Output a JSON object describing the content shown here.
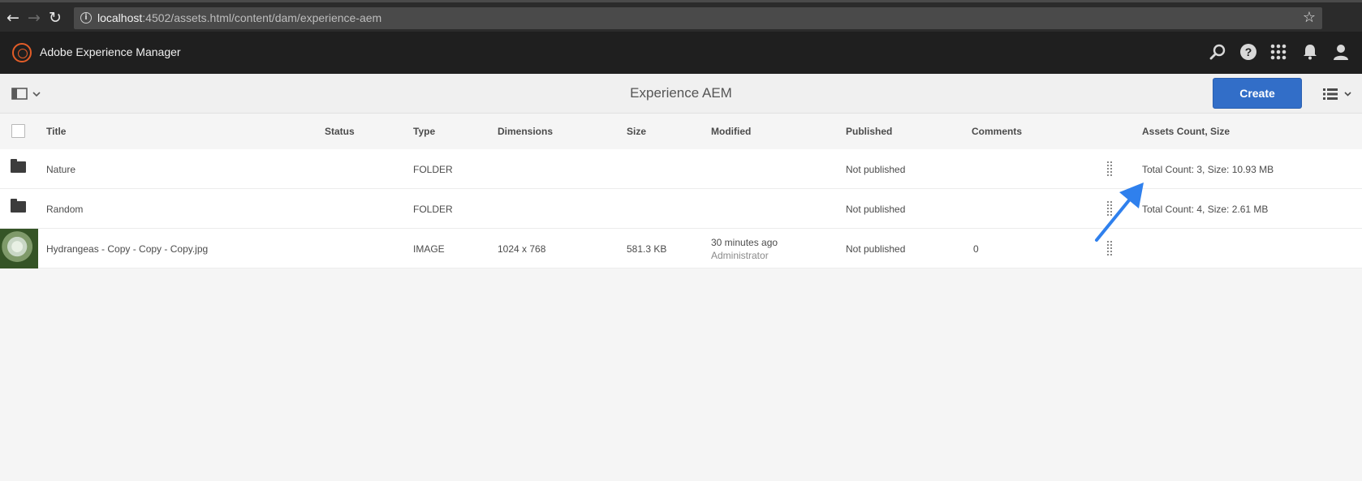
{
  "browser": {
    "url_host": "localhost",
    "url_rest": ":4502/assets.html/content/dam/experience-aem"
  },
  "header": {
    "app_title": "Adobe Experience Manager"
  },
  "action_bar": {
    "title": "Experience AEM",
    "create_label": "Create"
  },
  "table": {
    "columns": [
      "Title",
      "Status",
      "Type",
      "Dimensions",
      "Size",
      "Modified",
      "Published",
      "Comments",
      "Assets Count, Size"
    ],
    "rows": [
      {
        "title": "Nature",
        "type": "FOLDER",
        "published": "Not published",
        "assets": "Total Count: 3, Size: 10.93 MB"
      },
      {
        "title": "Random",
        "type": "FOLDER",
        "published": "Not published",
        "assets": "Total Count: 4, Size: 2.61 MB"
      },
      {
        "title": "Hydrangeas - Copy - Copy - Copy.jpg",
        "type": "IMAGE",
        "dimensions": "1024 x 768",
        "size": "581.3 KB",
        "modified": "30 minutes ago",
        "modified_by": "Administrator",
        "published": "Not published",
        "comments": "0"
      }
    ]
  },
  "icons": [
    "back-icon",
    "forward-icon",
    "reload-icon",
    "info-icon",
    "star-icon",
    "search-icon",
    "help-icon",
    "apps-icon",
    "bell-icon",
    "user-icon",
    "folder-icon",
    "drag-handle-icon",
    "list-view-icon"
  ],
  "colors": {
    "accent": "#326ec8",
    "arrow": "#2f80ed",
    "logo": "#e35d28"
  }
}
